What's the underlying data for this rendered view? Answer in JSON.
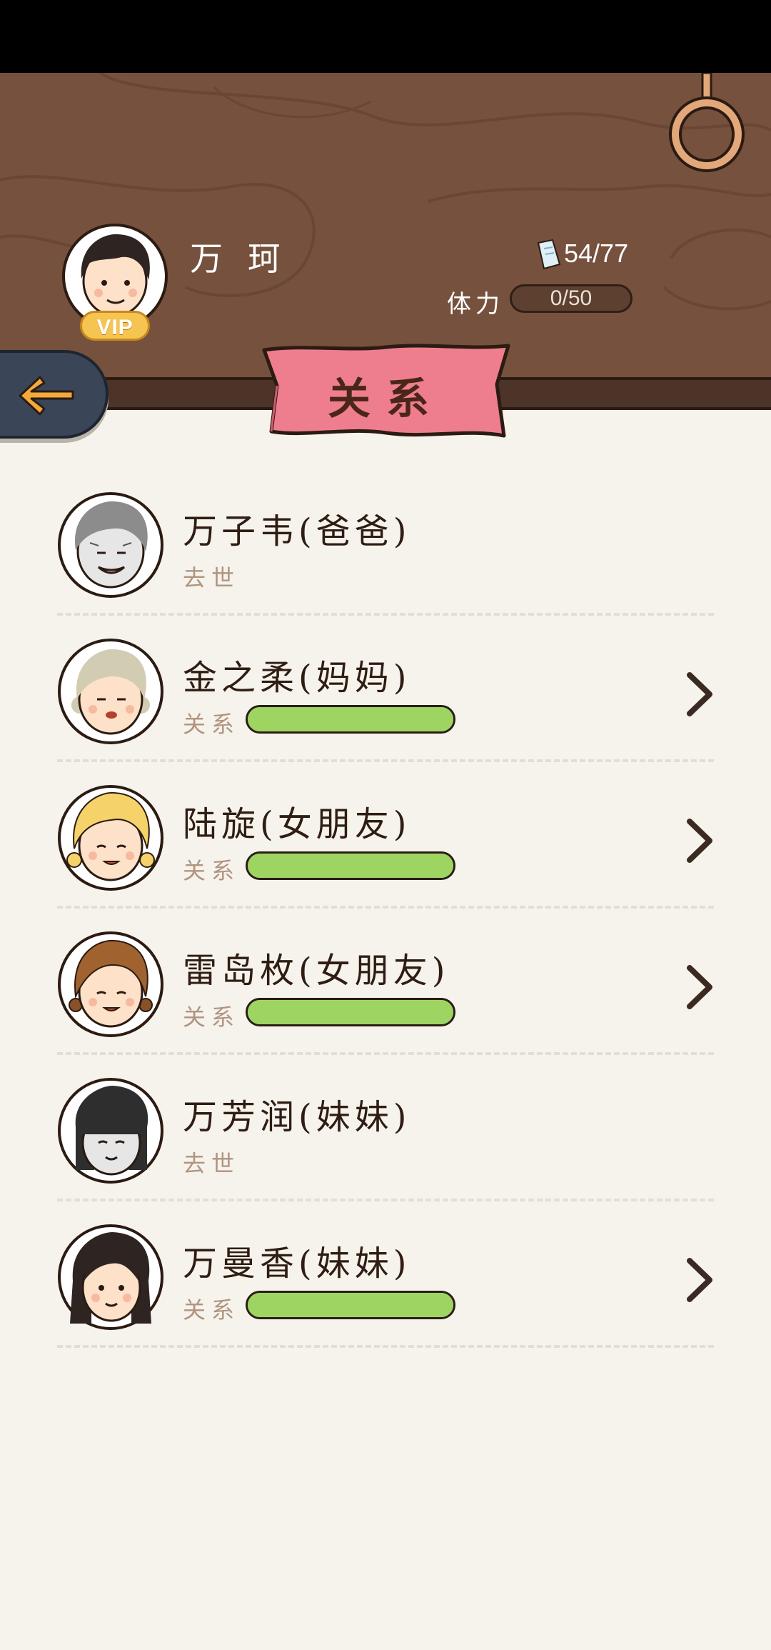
{
  "player": {
    "name": "万 珂",
    "vip_label": "VIP",
    "tickets": "54/77",
    "stamina_label": "体力",
    "stamina_value": "0/50"
  },
  "page": {
    "title": "关系"
  },
  "relatives": [
    {
      "name": "万子韦(爸爸)",
      "status": "去世",
      "deceased": true
    },
    {
      "name": "金之柔(妈妈)",
      "relation_label": "关系",
      "relation_level": 1.0,
      "deceased": false
    },
    {
      "name": "陆旋(女朋友)",
      "relation_label": "关系",
      "relation_level": 1.0,
      "deceased": false
    },
    {
      "name": "雷岛枚(女朋友)",
      "relation_label": "关系",
      "relation_level": 1.0,
      "deceased": false
    },
    {
      "name": "万芳润(妹妹)",
      "status": "去世",
      "deceased": true
    },
    {
      "name": "万曼香(妹妹)",
      "relation_label": "关系",
      "relation_level": 1.0,
      "deceased": false
    }
  ],
  "icons": {
    "back": "back-arrow-icon",
    "ring": "hanging-ring-icon",
    "ticket": "ticket-icon",
    "chevron": "chevron-right-icon"
  },
  "colors": {
    "header_wood": "#76513d",
    "banner_pink": "#ee7e8e",
    "relation_green": "#9ed462",
    "back_button": "#3a4658"
  }
}
